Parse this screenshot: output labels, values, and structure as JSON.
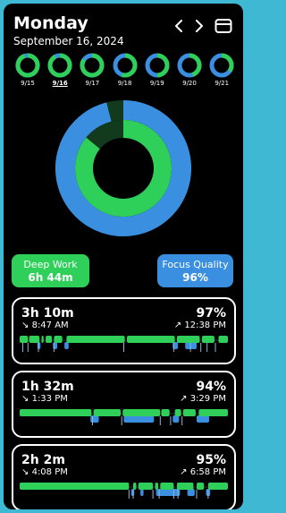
{
  "header": {
    "day": "Monday",
    "date": "September 16, 2024"
  },
  "colors": {
    "green": "#2fd05a",
    "blue": "#3a8fe0",
    "dark_green": "#123a1c",
    "background": "#000000",
    "frame": "#3fb8d4"
  },
  "icons": {
    "prev": "chevron-left-icon",
    "next": "chevron-right-icon",
    "view": "calendar-icon"
  },
  "week": [
    {
      "label": "9/15",
      "selected": false,
      "fill": 0.95
    },
    {
      "label": "9/16",
      "selected": true,
      "fill": 0.92
    },
    {
      "label": "9/17",
      "selected": false,
      "fill": 0.85
    },
    {
      "label": "9/18",
      "selected": false,
      "fill": 0.55
    },
    {
      "label": "9/19",
      "selected": false,
      "fill": 0.5
    },
    {
      "label": "9/20",
      "selected": false,
      "fill": 0.45
    },
    {
      "label": "9/21",
      "selected": false,
      "fill": 0.35
    }
  ],
  "summary": {
    "outer_ring_fraction": 0.96,
    "inner_ring_fraction": 0.86,
    "deep_work": {
      "label": "Deep Work",
      "value": "6h 44m"
    },
    "focus_quality": {
      "label": "Focus Quality",
      "value": "96%"
    }
  },
  "sessions": [
    {
      "duration": "3h 10m",
      "quality": "97%",
      "start": "8:47 AM",
      "end": "12:38 PM",
      "green": [
        [
          0.0,
          0.04
        ],
        [
          0.045,
          0.095
        ],
        [
          0.105,
          0.115
        ],
        [
          0.125,
          0.155
        ],
        [
          0.165,
          0.205
        ],
        [
          0.225,
          0.505
        ],
        [
          0.515,
          0.745
        ],
        [
          0.755,
          0.865
        ],
        [
          0.875,
          0.935
        ],
        [
          0.955,
          1.0
        ]
      ],
      "blue": [
        [
          0.085,
          0.1
        ],
        [
          0.16,
          0.18
        ],
        [
          0.215,
          0.235
        ],
        [
          0.735,
          0.76
        ],
        [
          0.795,
          0.85
        ]
      ],
      "ticks": [
        0.015,
        0.04,
        0.09,
        0.165,
        0.5,
        0.74,
        0.82,
        0.87,
        0.9,
        0.94
      ]
    },
    {
      "duration": "1h 32m",
      "quality": "94%",
      "start": "1:33 PM",
      "end": "3:29 PM",
      "green": [
        [
          0.0,
          0.345
        ],
        [
          0.355,
          0.485
        ],
        [
          0.495,
          0.675
        ],
        [
          0.68,
          0.72
        ],
        [
          0.745,
          0.775
        ],
        [
          0.785,
          0.845
        ],
        [
          0.86,
          1.0
        ]
      ],
      "blue": [
        [
          0.34,
          0.38
        ],
        [
          0.5,
          0.645
        ],
        [
          0.735,
          0.765
        ],
        [
          0.85,
          0.91
        ]
      ],
      "ticks": [
        0.35,
        0.49,
        0.675,
        0.725,
        0.78
      ]
    },
    {
      "duration": "2h 2m",
      "quality": "95%",
      "start": "4:08 PM",
      "end": "6:58 PM",
      "green": [
        [
          0.0,
          0.525
        ],
        [
          0.545,
          0.56
        ],
        [
          0.57,
          0.64
        ],
        [
          0.65,
          0.665
        ],
        [
          0.675,
          0.74
        ],
        [
          0.755,
          0.835
        ],
        [
          0.85,
          0.885
        ],
        [
          0.905,
          1.0
        ]
      ],
      "blue": [
        [
          0.535,
          0.55
        ],
        [
          0.58,
          0.595
        ],
        [
          0.655,
          0.77
        ],
        [
          0.805,
          0.84
        ],
        [
          0.895,
          0.915
        ]
      ],
      "ticks": [
        0.525,
        0.545,
        0.64,
        0.67,
        0.74,
        0.76,
        0.85,
        0.905
      ]
    }
  ]
}
